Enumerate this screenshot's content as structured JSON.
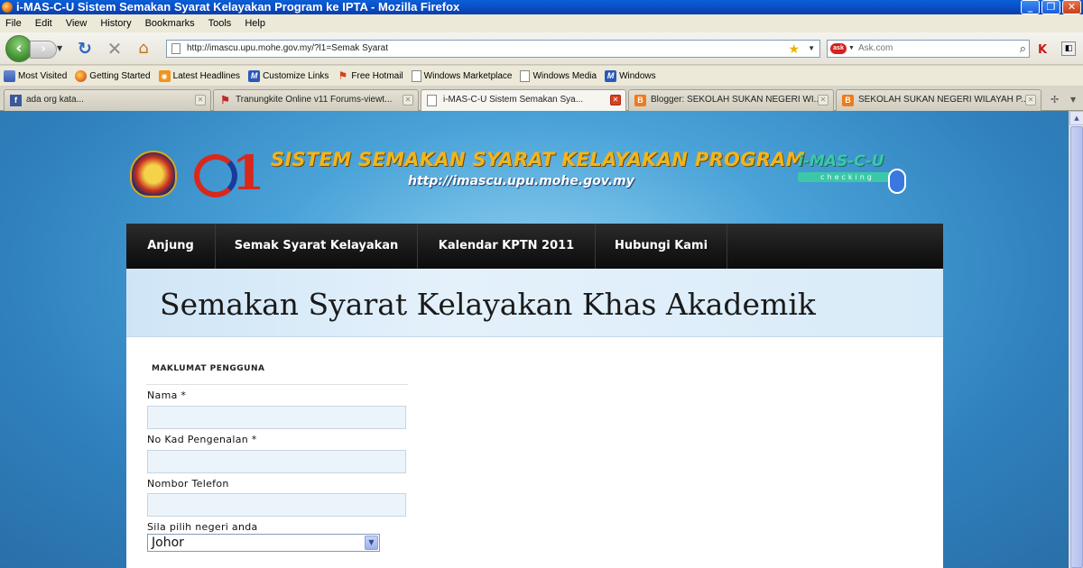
{
  "window": {
    "title": "i-MAS-C-U Sistem Semakan Syarat Kelayakan Program ke IPTA - Mozilla Firefox",
    "minimize": "_",
    "maximize": "❐",
    "close": "✕"
  },
  "menu": [
    "File",
    "Edit",
    "View",
    "History",
    "Bookmarks",
    "Tools",
    "Help"
  ],
  "navbar": {
    "url": "http://imascu.upu.mohe.gov.my/?l1=Semak Syarat",
    "search_placeholder": "Ask.com"
  },
  "bookmarks": [
    {
      "label": "Most Visited",
      "icon": "most-visited-icon"
    },
    {
      "label": "Getting Started",
      "icon": "firefox-icon"
    },
    {
      "label": "Latest Headlines",
      "icon": "rss-icon"
    },
    {
      "label": "Customize Links",
      "icon": "msn-icon"
    },
    {
      "label": "Free Hotmail",
      "icon": "windows-flag-icon"
    },
    {
      "label": "Windows Marketplace",
      "icon": "page-icon"
    },
    {
      "label": "Windows Media",
      "icon": "page-icon"
    },
    {
      "label": "Windows",
      "icon": "msn-icon"
    }
  ],
  "tabs": [
    {
      "label": "ada org kata...",
      "icon": "facebook-icon",
      "active": false
    },
    {
      "label": "Tranungkite Online v11 Forums-viewt...",
      "icon": "tranungkite-icon",
      "active": false
    },
    {
      "label": "i-MAS-C-U Sistem Semakan Sya...",
      "icon": "page-icon",
      "active": true
    },
    {
      "label": "Blogger: SEKOLAH SUKAN NEGERI WI...",
      "icon": "blogger-icon",
      "active": false
    },
    {
      "label": "SEKOLAH SUKAN NEGERI WILAYAH P...",
      "icon": "blogger-icon",
      "active": false
    }
  ],
  "banner": {
    "title": "SISTEM SEMAKAN SYARAT KELAYAKAN PROGRAM",
    "url": "http://imascu.upu.mohe.gov.my",
    "brand": "i-MAS-C-U",
    "brand_sub": "checking"
  },
  "site_nav": [
    "Anjung",
    "Semak Syarat Kelayakan",
    "Kalendar KPTN 2011",
    "Hubungi Kami"
  ],
  "page_title": "Semakan Syarat Kelayakan Khas Akademik",
  "form": {
    "section_title": "MAKLUMAT PENGGUNA",
    "name_label": "Nama *",
    "name_value": "",
    "ic_label": "No Kad Pengenalan *",
    "ic_value": "",
    "phone_label": "Nombor Telefon",
    "phone_value": "",
    "state_label": "Sila pilih negeri anda",
    "state_selected": "Johor"
  },
  "colors": {
    "banner_title": "#f2b41c",
    "nav_bg": "#1a1a1a",
    "page_head_bg": "#e4f1fb",
    "input_bg": "#ecf4fb"
  }
}
